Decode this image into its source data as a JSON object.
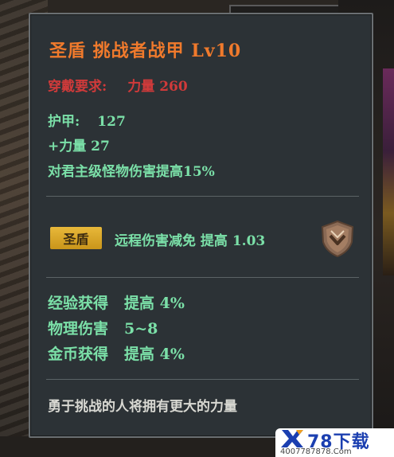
{
  "item": {
    "title": "圣盾 挑战者战甲 Lv10",
    "requirement_label": "穿戴要求:",
    "requirement_value": "力量 260",
    "stats": [
      {
        "label": "护甲:",
        "value": "127"
      },
      {
        "label": "+力量 27",
        "value": ""
      },
      {
        "label": "对君主级怪物伤害提高15%",
        "value": ""
      }
    ],
    "set": {
      "badge": "圣盾",
      "effect": "远程伤害减免 提高 1.03",
      "icon": "shield-emblem-icon"
    },
    "bonuses": [
      {
        "label": "经验获得",
        "value": "提高 4%"
      },
      {
        "label": "物理伤害",
        "value": "5~8"
      },
      {
        "label": "金币获得",
        "value": "提高 4%"
      }
    ],
    "flavor": "勇于挑战的人将拥有更大的力量"
  },
  "watermark": {
    "brand": "78下载",
    "url": "4007787878.Com"
  },
  "colors": {
    "title": "#f07a2c",
    "requirement": "#d03a3a",
    "stat": "#7be0a8",
    "badge": "#e8b83a",
    "flavor": "#d8d8d2",
    "panel": "#2c3236"
  }
}
